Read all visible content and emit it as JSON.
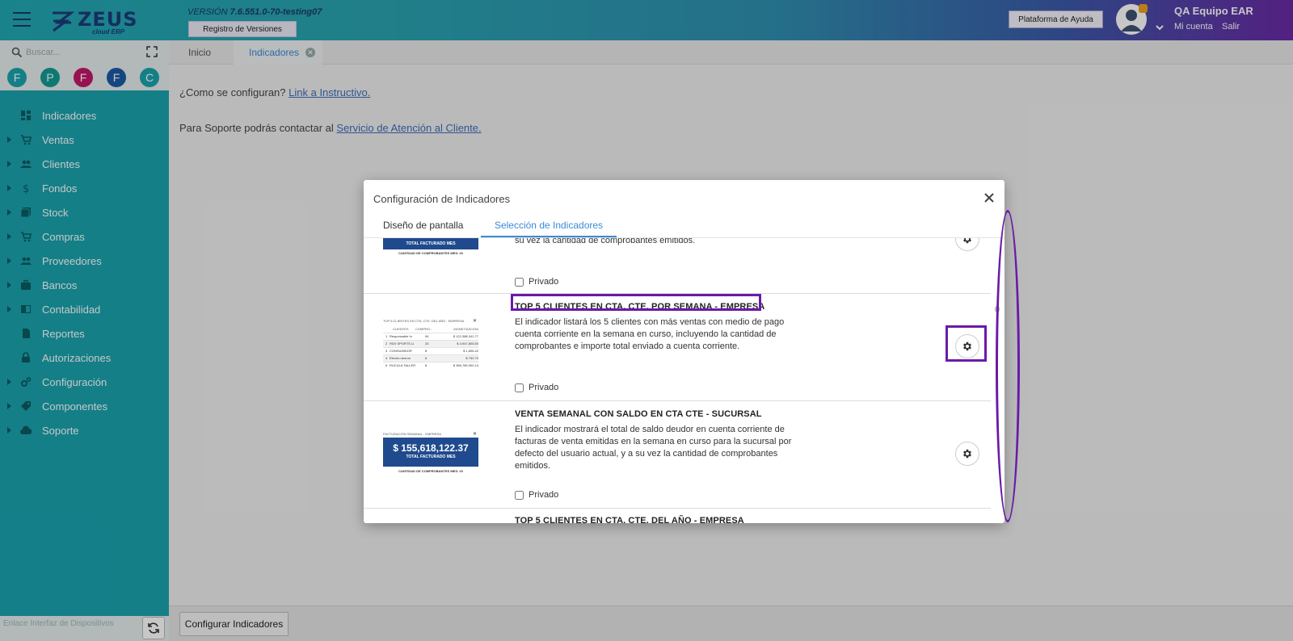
{
  "header": {
    "logo_text": "ZEUS",
    "logo_sub": "cloud ERP",
    "version_label": "VERSIÓN",
    "version_value": "7.6.551.0-70-testing07",
    "versions_button": "Registro de Versiones",
    "help_button": "Plataforma de Ayuda",
    "user_name": "QA Equipo EAR",
    "account_link": "Mi cuenta",
    "logout_link": "Salir"
  },
  "sidebar": {
    "search_placeholder": "Buscar...",
    "quick_access": [
      {
        "letter": "F",
        "color": "#1aa3ae"
      },
      {
        "letter": "P",
        "color": "#139b94"
      },
      {
        "letter": "F",
        "color": "#c2186b"
      },
      {
        "letter": "F",
        "color": "#1b5aa6"
      },
      {
        "letter": "C",
        "color": "#1aa3ae"
      }
    ],
    "items": [
      {
        "label": "Indicadores",
        "icon": "dashboard-icon",
        "has_children": false
      },
      {
        "label": "Ventas",
        "icon": "cart-icon",
        "has_children": true
      },
      {
        "label": "Clientes",
        "icon": "people-icon",
        "has_children": true
      },
      {
        "label": "Fondos",
        "icon": "dollar-icon",
        "has_children": true
      },
      {
        "label": "Stock",
        "icon": "stock-icon",
        "has_children": true
      },
      {
        "label": "Compras",
        "icon": "cart-add-icon",
        "has_children": true
      },
      {
        "label": "Proveedores",
        "icon": "people-icon",
        "has_children": true
      },
      {
        "label": "Bancos",
        "icon": "briefcase-icon",
        "has_children": true
      },
      {
        "label": "Contabilidad",
        "icon": "book-icon",
        "has_children": true
      },
      {
        "label": "Reportes",
        "icon": "report-icon",
        "has_children": false
      },
      {
        "label": "Autorizaciones",
        "icon": "lock-icon",
        "has_children": false
      },
      {
        "label": "Configuración",
        "icon": "gears-icon",
        "has_children": true
      },
      {
        "label": "Componentes",
        "icon": "tag-icon",
        "has_children": true
      },
      {
        "label": "Soporte",
        "icon": "cloud-icon",
        "has_children": true
      }
    ],
    "footer_text": "Enlace Interfaz de Dispositivos"
  },
  "tabs": [
    {
      "label": "Inicio",
      "active": false
    },
    {
      "label": "Indicadores",
      "active": true
    }
  ],
  "main": {
    "config_question": "¿Como se configuran?",
    "config_link": "Link a Instructivo.",
    "support_text": "Para Soporte podrás contactar al",
    "support_link": "Servicio de Atención al Cliente.",
    "configure_button": "Configurar Indicadores"
  },
  "modal": {
    "title": "Configuración de Indicadores",
    "tab_design": "Diseño de pantalla",
    "tab_selection": "Selección de Indicadores",
    "private_label": "Privado",
    "partial_card": {
      "desc_tail": "su vez la cantidad de comprobantes emitidos.",
      "thumb_label": "TOTAL FACTURADO MES",
      "thumb_caption": "CANTIDAD DE COMPROBANTES MES: 20"
    },
    "card_top5_week": {
      "title": "TOP 5 CLIENTES EN CTA. CTE. POR SEMANA - EMPRESA",
      "desc": "El indicador listará los 5 clientes con más ventas con medio de pago cuenta corriente en la semana en curso, incluyendo la cantidad de comprobantes e importe total enviado a cuenta corriente.",
      "thumb_title": "TOP 5 CLIENTES EN CTA. CTE. DEL AÑO - EMPRESA",
      "thumb_headers": [
        "CLIENTES",
        "COMPRO...",
        "MONETIZACION"
      ],
      "thumb_rows": [
        [
          "1",
          "Responsable In",
          "94",
          "$ 122,388,341.77"
        ],
        [
          "2",
          "RDX SPORTS LI",
          "33",
          "$ 4,947,805.50"
        ],
        [
          "3",
          "CONSUMIDOR",
          "8",
          "$ 1,806.42"
        ],
        [
          "4",
          "Electro neuron",
          "8",
          "$ 752.70"
        ],
        [
          "5",
          "RUCULA TALLER",
          "8",
          "$ 356,789,300.14"
        ]
      ]
    },
    "card_weekly_sale": {
      "title": "VENTA SEMANAL CON SALDO EN CTA CTE - SUCURSAL",
      "desc": "El indicador mostrará el total de saldo deudor en cuenta corriente de facturas de venta emitidas en la semana en curso para la sucursal por defecto del usuario actual, y a su vez la cantidad de comprobantes emitidos.",
      "thumb_title": "FACTURACIÓN SEMANAL - EMPRESA",
      "thumb_amount": "$ 155,618,122.37",
      "thumb_label": "TOTAL FACTURADO MES",
      "thumb_caption": "CANTIDAD DE COMPROBANTES MES: 20"
    },
    "card_top5_year": {
      "title": "TOP 5 CLIENTES EN CTA. CTE. DEL AÑO - EMPRESA"
    }
  },
  "colors": {
    "sidebar": "#1aa3ae",
    "accent": "#3b8ad8",
    "highlight": "#6a1aa8",
    "thumb_blue": "#1f4a8e"
  }
}
